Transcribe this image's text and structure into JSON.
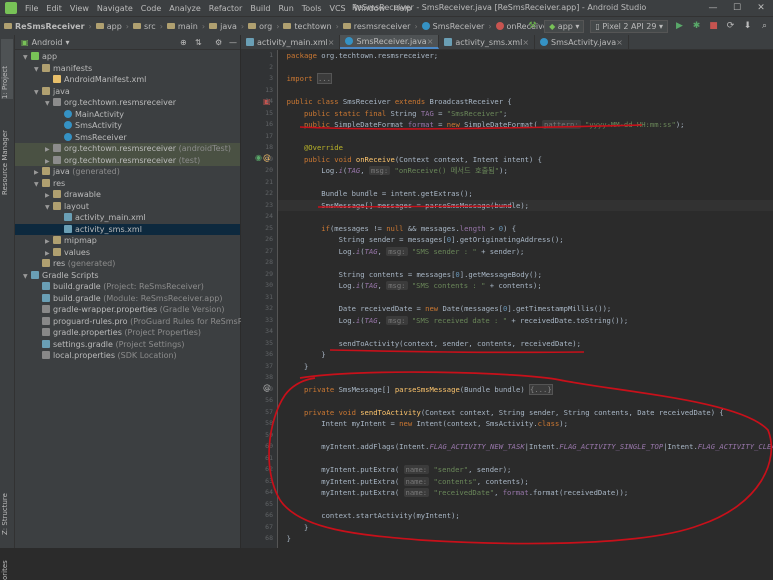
{
  "menubar": {
    "items": [
      "File",
      "Edit",
      "View",
      "Navigate",
      "Code",
      "Analyze",
      "Refactor",
      "Build",
      "Run",
      "Tools",
      "VCS",
      "Window",
      "Help"
    ],
    "window_title": "ReSmsReceiver - SmsReceiver.java [ReSmsReceiver.app] - Android Studio"
  },
  "breadcrumbs": [
    "ReSmsReceiver",
    "app",
    "src",
    "main",
    "java",
    "org",
    "techtown",
    "resmsreceiver",
    "SmsReceiver",
    "onReceive"
  ],
  "toolbar": {
    "run_config": "app",
    "device": "Pixel 2 API 29"
  },
  "left_tabs": {
    "project": "1: Project",
    "resource_manager": "Resource Manager",
    "structure": "Z: Structure",
    "favorites": "orites"
  },
  "project_panel": {
    "view_selector": "Android",
    "tree": [
      {
        "label": "app",
        "note": "",
        "indent": 0,
        "icon": "module",
        "arrow": "▼"
      },
      {
        "label": "manifests",
        "note": "",
        "indent": 1,
        "icon": "folder",
        "arrow": "▼"
      },
      {
        "label": "AndroidManifest.xml",
        "note": "",
        "indent": 2,
        "icon": "xml",
        "arrow": ""
      },
      {
        "label": "java",
        "note": "",
        "indent": 1,
        "icon": "folder",
        "arrow": "▼"
      },
      {
        "label": "org.techtown.resmsreceiver",
        "note": "",
        "indent": 2,
        "icon": "package",
        "arrow": "▼"
      },
      {
        "label": "MainActivity",
        "note": "",
        "indent": 3,
        "icon": "class",
        "arrow": ""
      },
      {
        "label": "SmsActivity",
        "note": "",
        "indent": 3,
        "icon": "class",
        "arrow": ""
      },
      {
        "label": "SmsReceiver",
        "note": "",
        "indent": 3,
        "icon": "class",
        "arrow": ""
      },
      {
        "label": "org.techtown.resmsreceiver",
        "note": "(androidTest)",
        "indent": 2,
        "icon": "package",
        "arrow": "▶"
      },
      {
        "label": "org.techtown.resmsreceiver",
        "note": "(test)",
        "indent": 2,
        "icon": "package",
        "arrow": "▶"
      },
      {
        "label": "java",
        "note": "(generated)",
        "indent": 1,
        "icon": "folder",
        "arrow": "▶"
      },
      {
        "label": "res",
        "note": "",
        "indent": 1,
        "icon": "folder",
        "arrow": "▼"
      },
      {
        "label": "drawable",
        "note": "",
        "indent": 2,
        "icon": "folder",
        "arrow": "▶"
      },
      {
        "label": "layout",
        "note": "",
        "indent": 2,
        "icon": "folder",
        "arrow": "▼"
      },
      {
        "label": "activity_main.xml",
        "note": "",
        "indent": 3,
        "icon": "layout",
        "arrow": ""
      },
      {
        "label": "activity_sms.xml",
        "note": "",
        "indent": 3,
        "icon": "layout",
        "arrow": ""
      },
      {
        "label": "mipmap",
        "note": "",
        "indent": 2,
        "icon": "folder",
        "arrow": "▶"
      },
      {
        "label": "values",
        "note": "",
        "indent": 2,
        "icon": "folder",
        "arrow": "▶"
      },
      {
        "label": "res",
        "note": "(generated)",
        "indent": 1,
        "icon": "folder",
        "arrow": ""
      },
      {
        "label": "Gradle Scripts",
        "note": "",
        "indent": 0,
        "icon": "gradle",
        "arrow": "▼"
      },
      {
        "label": "build.gradle",
        "note": "(Project: ReSmsReceiver)",
        "indent": 1,
        "icon": "gradle",
        "arrow": ""
      },
      {
        "label": "build.gradle",
        "note": "(Module: ReSmsReceiver.app)",
        "indent": 1,
        "icon": "gradle",
        "arrow": ""
      },
      {
        "label": "gradle-wrapper.properties",
        "note": "(Gradle Version)",
        "indent": 1,
        "icon": "props",
        "arrow": ""
      },
      {
        "label": "proguard-rules.pro",
        "note": "(ProGuard Rules for ReSmsReceiver.app)",
        "indent": 1,
        "icon": "props",
        "arrow": ""
      },
      {
        "label": "gradle.properties",
        "note": "(Project Properties)",
        "indent": 1,
        "icon": "props",
        "arrow": ""
      },
      {
        "label": "settings.gradle",
        "note": "(Project Settings)",
        "indent": 1,
        "icon": "gradle",
        "arrow": ""
      },
      {
        "label": "local.properties",
        "note": "(SDK Location)",
        "indent": 1,
        "icon": "props",
        "arrow": ""
      }
    ],
    "selected_index": 15,
    "highlighted_indices": [
      8,
      9
    ]
  },
  "editor_tabs": [
    {
      "label": "activity_main.xml",
      "icon": "layout",
      "active": false
    },
    {
      "label": "SmsReceiver.java",
      "icon": "class",
      "active": true
    },
    {
      "label": "activity_sms.xml",
      "icon": "layout",
      "active": false
    },
    {
      "label": "SmsActivity.java",
      "icon": "class",
      "active": false
    }
  ],
  "code_lines": [
    {
      "n": "1",
      "y": 0,
      "html": "<span class='kw'>package </span>org.techtown.resmsreceiver;"
    },
    {
      "n": "2",
      "y": 1,
      "html": ""
    },
    {
      "n": "3",
      "y": 2,
      "html": "<span class='kw'>import </span><span class='fold'>...</span>"
    },
    {
      "n": "13",
      "y": 3,
      "html": ""
    },
    {
      "n": "14",
      "y": 4,
      "html": "<span class='kw'>public class </span>SmsReceiver <span class='kw'>extends </span>BroadcastReceiver {"
    },
    {
      "n": "15",
      "y": 5,
      "html": "    <span class='kw'>public static final </span>String <span class='fld'>TAG</span> = <span class='str'>\"SmsReceiver\"</span>;"
    },
    {
      "n": "16",
      "y": 6,
      "html": "    <span class='kw'>public </span>SimpleDateFormat <span class='fld'>format</span> = <span class='kw'>new </span>SimpleDateFormat( <span class='hint'>pattern:</span> <span class='str'>\"yyyy-MM-dd HH:mm:ss\"</span>);"
    },
    {
      "n": "17",
      "y": 7,
      "html": ""
    },
    {
      "n": "18",
      "y": 8,
      "html": "    <span class='ann'>@Override</span>"
    },
    {
      "n": "19",
      "y": 9,
      "html": "    <span class='kw'>public void </span><span class='fn'>onReceive</span>(Context context, Intent intent) {"
    },
    {
      "n": "20",
      "y": 10,
      "html": "        Log.<span class='itf'>i</span>(<span class='itf'>TAG</span>, <span class='hint'>msg:</span> <span class='str'>\"onReceive() 메서드 호출됨\"</span>);"
    },
    {
      "n": "21",
      "y": 11,
      "html": ""
    },
    {
      "n": "22",
      "y": 12,
      "html": "        Bundle bundle = intent.getExtras();"
    },
    {
      "n": "23",
      "y": 13,
      "html": "        SmsMessage[] messages = parseSmsMessage(bundle);",
      "hl": true
    },
    {
      "n": "24",
      "y": 14,
      "html": ""
    },
    {
      "n": "25",
      "y": 15,
      "html": "        <span class='kw'>if</span>(messages != <span class='kw'>null </span>&amp;&amp; messages.<span class='fld'>length</span> &gt; <span class='num'>0</span>) {"
    },
    {
      "n": "26",
      "y": 16,
      "html": "            String sender = messages[<span class='num'>0</span>].getOriginatingAddress();"
    },
    {
      "n": "27",
      "y": 17,
      "html": "            Log.<span class='itf'>i</span>(<span class='itf'>TAG</span>, <span class='hint'>msg:</span> <span class='str'>\"SMS sender : \"</span> + sender);"
    },
    {
      "n": "28",
      "y": 18,
      "html": ""
    },
    {
      "n": "29",
      "y": 19,
      "html": "            String contents = messages[<span class='num'>0</span>].getMessageBody();"
    },
    {
      "n": "30",
      "y": 20,
      "html": "            Log.<span class='itf'>i</span>(<span class='itf'>TAG</span>, <span class='hint'>msg:</span> <span class='str'>\"SMS contents : \"</span> + contents);"
    },
    {
      "n": "31",
      "y": 21,
      "html": ""
    },
    {
      "n": "32",
      "y": 22,
      "html": "            Date receivedDate = <span class='kw'>new </span>Date(messages[<span class='num'>0</span>].getTimestampMillis());"
    },
    {
      "n": "33",
      "y": 23,
      "html": "            Log.<span class='itf'>i</span>(<span class='itf'>TAG</span>, <span class='hint'>msg:</span> <span class='str'>\"SMS received date : \"</span> + receivedDate.toString());"
    },
    {
      "n": "34",
      "y": 24,
      "html": ""
    },
    {
      "n": "35",
      "y": 25,
      "html": "            sendToActivity(context, sender, contents, receivedDate);"
    },
    {
      "n": "36",
      "y": 26,
      "html": "        }"
    },
    {
      "n": "37",
      "y": 27,
      "html": "    }"
    },
    {
      "n": "38",
      "y": 28,
      "html": ""
    },
    {
      "n": "39",
      "y": 29,
      "html": "    <span class='kw'>private </span>SmsMessage[] <span class='fn'>parseSmsMessage</span>(Bundle bundle) <span class='fold'>{...}</span>"
    },
    {
      "n": "56",
      "y": 30,
      "html": ""
    },
    {
      "n": "57",
      "y": 31,
      "html": "    <span class='kw'>private void </span><span class='fn'>sendToActivity</span>(Context context, String sender, String contents, Date receivedDate) {"
    },
    {
      "n": "58",
      "y": 32,
      "html": "        Intent myIntent = <span class='kw'>new </span>Intent(context, SmsActivity.<span class='kw'>class</span>);"
    },
    {
      "n": "59",
      "y": 33,
      "html": ""
    },
    {
      "n": "60",
      "y": 34,
      "html": "        myIntent.addFlags(Intent.<span class='itf'>FLAG_ACTIVITY_NEW_TASK</span>|Intent.<span class='itf'>FLAG_ACTIVITY_SINGLE_TOP</span>|Intent.<span class='itf'>FLAG_ACTIVITY_CLEAR_TOP</span>);"
    },
    {
      "n": "61",
      "y": 35,
      "html": ""
    },
    {
      "n": "62",
      "y": 36,
      "html": "        myIntent.putExtra( <span class='hint'>name:</span> <span class='str'>\"sender\"</span>, sender);"
    },
    {
      "n": "63",
      "y": 37,
      "html": "        myIntent.putExtra( <span class='hint'>name:</span> <span class='str'>\"contents\"</span>, contents);"
    },
    {
      "n": "64",
      "y": 38,
      "html": "        myIntent.putExtra( <span class='hint'>name:</span> <span class='str'>\"receivedDate\"</span>, <span class='fld'>format</span>.format(receivedDate));"
    },
    {
      "n": "65",
      "y": 39,
      "html": ""
    },
    {
      "n": "66",
      "y": 40,
      "html": "        context.startActivity(myIntent);"
    },
    {
      "n": "67",
      "y": 41,
      "html": "    }"
    },
    {
      "n": "68",
      "y": 42,
      "html": "}"
    }
  ],
  "colors": {
    "annotation_red": "#c8101a",
    "selection": "#0d293e",
    "highlight_row": "#4a5143"
  }
}
